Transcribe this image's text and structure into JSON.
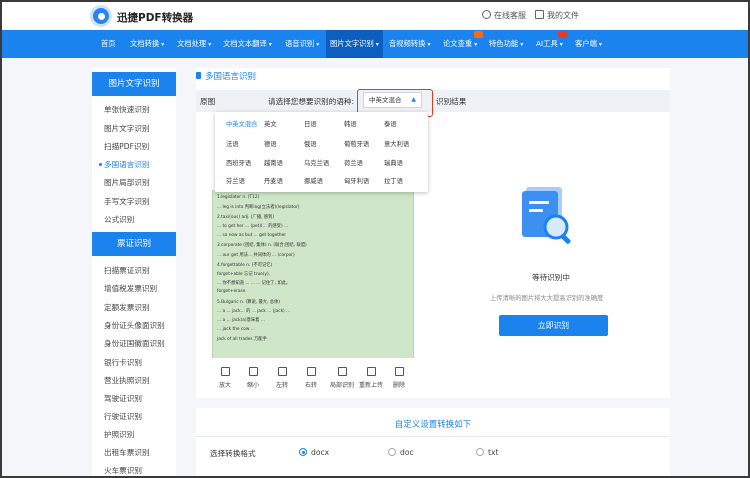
{
  "header": {
    "brand": "迅捷PDF转换器",
    "service": "在线客服",
    "my_files": "我的文件"
  },
  "nav": {
    "items": [
      {
        "label": "首页",
        "caret": false
      },
      {
        "label": "文档转换",
        "caret": true
      },
      {
        "label": "文档处理",
        "caret": true
      },
      {
        "label": "文档文本翻译",
        "caret": true
      },
      {
        "label": "语音识别",
        "caret": true
      },
      {
        "label": "图片文字识别",
        "caret": true
      },
      {
        "label": "音视频转换",
        "caret": true
      },
      {
        "label": "论文查重",
        "caret": true
      },
      {
        "label": "特色功能",
        "caret": true
      },
      {
        "label": "AI工具",
        "caret": true
      },
      {
        "label": "客户端",
        "caret": true
      }
    ]
  },
  "sidebar": {
    "section1_title": "图片文字识别",
    "section1_items": [
      "单张快速识别",
      "图片文字识别",
      "扫描PDF识别",
      "多国语言识别",
      "图片局部识别",
      "手写文字识别",
      "公式识别"
    ],
    "section2_title": "票证识别",
    "section2_items": [
      "扫描票证识别",
      "增值税发票识别",
      "定额发票识别",
      "身份证头像面识别",
      "身份证国徽面识别",
      "银行卡识别",
      "营业执照识别",
      "驾驶证识别",
      "行驶证识别",
      "护照识别",
      "出租车票识别",
      "火车票识别"
    ]
  },
  "main": {
    "title": "多国语言识别",
    "original_label": "原图",
    "prompt": "请选择您想要识别的语种:",
    "selected_language": "中英文混合",
    "result_label": "识别结果",
    "languages": [
      "中英文混合",
      "英文",
      "日语",
      "韩语",
      "泰语",
      "法语",
      "德语",
      "俄语",
      "葡萄牙语",
      "意大利语",
      "西班牙语",
      "越南语",
      "乌克兰语",
      "荷兰语",
      "瑞典语",
      "芬兰语",
      "丹麦语",
      "挪威语",
      "匈牙利语",
      "拉丁语"
    ],
    "preview_lines": [
      "1.legislator n. (T12)",
      "  ... leg is into 判断log(立法者)(legislator)",
      "2.taxi(ous) adj. (广播, 感到)",
      "  ... to get her ... (pet)(... 的感受) ...",
      "  ... so now as but ... get together",
      "3.corporate (团结, 集体) n. (联合;团结, 联盟)",
      "  ... our get 用法... 共同体的 ... (corpor)",
      "4.forgettable n. (不可记忆)",
      "  forget+able 忘记 true(y),",
      "  ... 你不想知道 ... ... ... 记住了, 如此。",
      "forget+erase",
      "5.Bulgaric n. (算说, 最大, 总体)",
      "  ... a ... jack... 的 ... jack ... (jack) ...",
      "  ... a ... jack(a)意味着 ...",
      "  ... jack the cow ...",
      "  jack of all trades 万能手"
    ],
    "tools": [
      "放大",
      "缩小",
      "左转",
      "右转",
      "局部识别",
      "重新上传",
      "删除"
    ],
    "waiting": "等待识别中",
    "hint": "上传清晰的图片将大大提高识别的准确度",
    "start_button": "立即识别"
  },
  "custom": {
    "title": "自定义设置转换如下",
    "format_label": "选择转换格式",
    "formats": [
      "docx",
      "doc",
      "txt"
    ],
    "selected_format": "docx"
  },
  "colors": {
    "accent": "#1a83ed",
    "highlight_border": "#e23b2c",
    "preview_bg": "#cfe6c8"
  }
}
